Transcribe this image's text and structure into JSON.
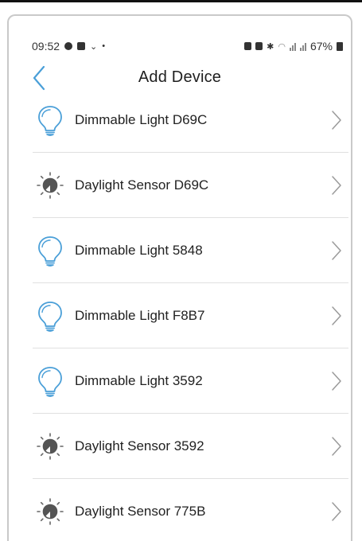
{
  "status_bar": {
    "time": "09:52",
    "battery": "67%"
  },
  "header": {
    "title": "Add Device"
  },
  "devices": [
    {
      "label": "Dimmable Light D69C",
      "icon": "lightbulb-icon"
    },
    {
      "label": "Daylight Sensor D69C",
      "icon": "daylight-sensor-icon"
    },
    {
      "label": "Dimmable Light 5848",
      "icon": "lightbulb-icon"
    },
    {
      "label": "Dimmable Light F8B7",
      "icon": "lightbulb-icon"
    },
    {
      "label": "Dimmable Light 3592",
      "icon": "lightbulb-icon"
    },
    {
      "label": "Daylight Sensor 3592",
      "icon": "daylight-sensor-icon"
    },
    {
      "label": "Daylight Sensor 775B",
      "icon": "daylight-sensor-icon"
    }
  ],
  "colors": {
    "accent": "#4a9fd8",
    "text": "#222222",
    "divider": "#e0e0e0",
    "sensor": "#555555"
  }
}
